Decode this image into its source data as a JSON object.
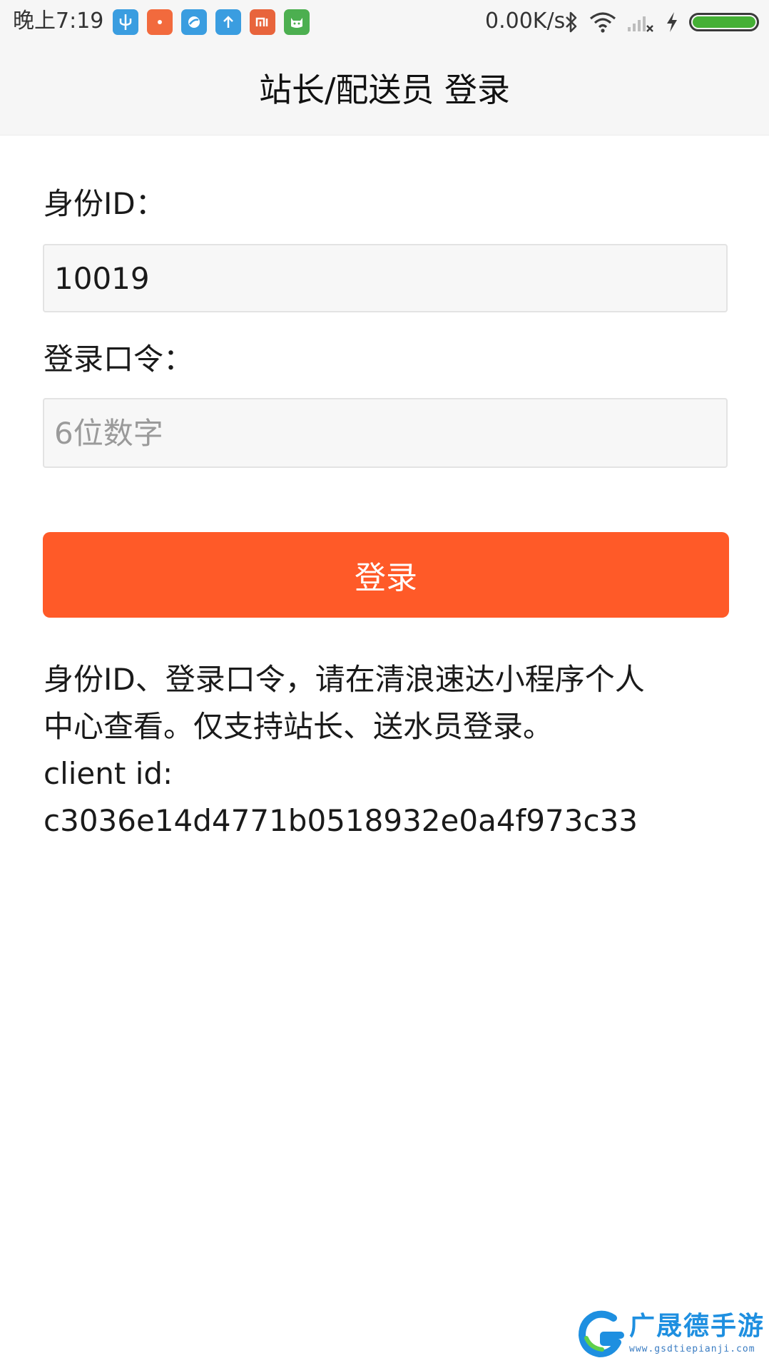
{
  "status_bar": {
    "time": "晚上7:19",
    "net_speed": "0.00K/s",
    "notification_icons": [
      {
        "name": "usb-icon",
        "glyph": "Ψ",
        "color": "#3a9de0"
      },
      {
        "name": "app-orange-icon",
        "glyph": "•",
        "color": "#f26a3d"
      },
      {
        "name": "browser-icon",
        "glyph": "◐",
        "color": "#3a9de0"
      },
      {
        "name": "upload-icon",
        "glyph": "↑",
        "color": "#3a9de0"
      },
      {
        "name": "mi-icon",
        "glyph": "mi",
        "color": "#e8643c"
      },
      {
        "name": "cat-app-icon",
        "glyph": "☺",
        "color": "#4caf50"
      }
    ],
    "icons": [
      "bluetooth-icon",
      "wifi-icon",
      "signal-icon",
      "charging-icon",
      "battery-icon"
    ],
    "battery_level": 1.0
  },
  "header": {
    "title": "站长/配送员 登录"
  },
  "form": {
    "id_label": "身份ID：",
    "id_value": "10019",
    "password_label": "登录口令：",
    "password_placeholder": "6位数字",
    "login_button_label": "登录"
  },
  "info": {
    "line1": "身份ID、登录口令，请在清浪速达小程序个人",
    "line2": "中心查看。仅支持站长、送水员登录。",
    "line3": "client id:",
    "line4": "c3036e14d4771b0518932e0a4f973c33"
  },
  "watermark": {
    "title": "广晟德手游",
    "url": "www.gsdtiepianji.com"
  },
  "colors": {
    "accent": "#ff5a28",
    "bar_bg": "#f6f6f6",
    "field_bg": "#f7f7f7",
    "battery": "#45b035"
  }
}
